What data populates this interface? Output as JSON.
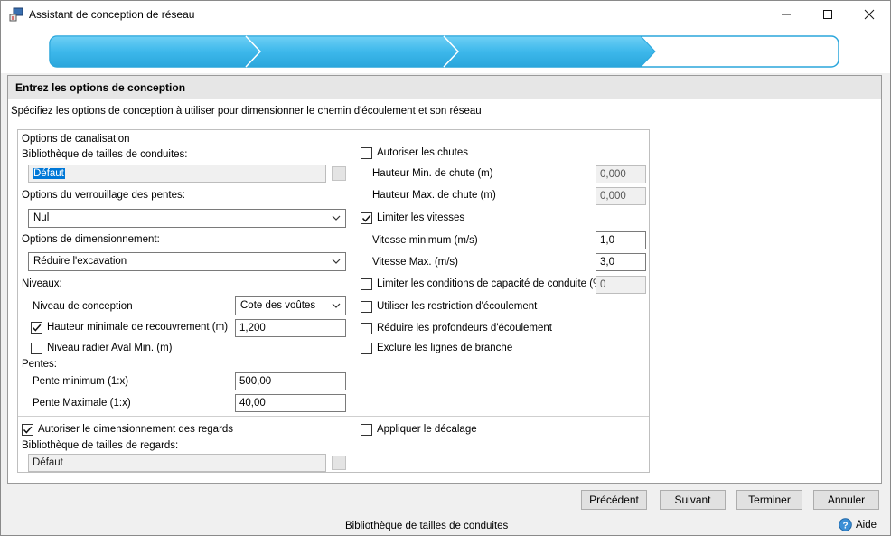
{
  "window": {
    "title": "Assistant de conception de réseau",
    "minimize": "—",
    "maximize": "☐",
    "close": "✕"
  },
  "panel": {
    "header": "Entrez les options de conception",
    "description": "Spécifiez les options de conception à utiliser pour dimensionner le chemin d'écoulement et son réseau"
  },
  "pipe_options": {
    "group_title": "Options de canalisation",
    "library_label": "Bibliothèque de tailles de conduites:",
    "library_value": "Défaut",
    "slope_lock_label": "Options du verrouillage des pentes:",
    "slope_lock_value": "Nul",
    "sizing_label": "Options de dimensionnement:",
    "sizing_value": "Réduire l'excavation",
    "levels_label": "Niveaux:",
    "design_level_label": "Niveau de conception",
    "design_level_value": "Cote des voûtes",
    "min_cover_label": "Hauteur minimale de recouvrement (m)",
    "min_cover_checked": true,
    "min_cover_value": "1,200",
    "min_invert_label": "Niveau radier Aval Min. (m)",
    "min_invert_checked": false,
    "slopes_label": "Pentes:",
    "min_slope_label": "Pente minimum (1:x)",
    "min_slope_value": "500,00",
    "max_slope_label": "Pente Maximale (1:x)",
    "max_slope_value": "40,00"
  },
  "right_options": {
    "allow_drops_label": "Autoriser les chutes",
    "allow_drops_checked": false,
    "min_drop_label": "Hauteur Min. de chute (m)",
    "min_drop_value": "0,000",
    "max_drop_label": "Hauteur Max. de chute (m)",
    "max_drop_value": "0,000",
    "limit_velocity_label": "Limiter les vitesses",
    "limit_velocity_checked": true,
    "min_velocity_label": "Vitesse minimum (m/s)",
    "min_velocity_value": "1,0",
    "max_velocity_label": "Vitesse Max. (m/s)",
    "max_velocity_value": "3,0",
    "limit_capacity_label": "Limiter les conditions de capacité de conduite (%)",
    "limit_capacity_checked": false,
    "limit_capacity_value": "0",
    "flow_restriction_label": "Utiliser les restriction d'écoulement",
    "flow_restriction_checked": false,
    "reduce_depth_label": "Réduire les profondeurs d'écoulement",
    "reduce_depth_checked": false,
    "exclude_branch_label": "Exclure les lignes de branche",
    "exclude_branch_checked": false
  },
  "manhole_options": {
    "allow_sizing_label": "Autoriser le dimensionnement des regards",
    "allow_sizing_checked": true,
    "library_label": "Bibliothèque de tailles de regards:",
    "library_value": "Défaut",
    "apply_offset_label": "Appliquer le décalage",
    "apply_offset_checked": false
  },
  "buttons": {
    "previous": "Précédent",
    "next": "Suivant",
    "finish": "Terminer",
    "cancel": "Annuler"
  },
  "status": {
    "text": "Bibliothèque de tailles de conduites",
    "help": "Aide"
  },
  "colors": {
    "step_active": "#3db8eb",
    "step_inactive": "#ffffff",
    "selection": "#0078d7"
  },
  "progress": {
    "total_steps": 4,
    "completed_steps": 3
  }
}
